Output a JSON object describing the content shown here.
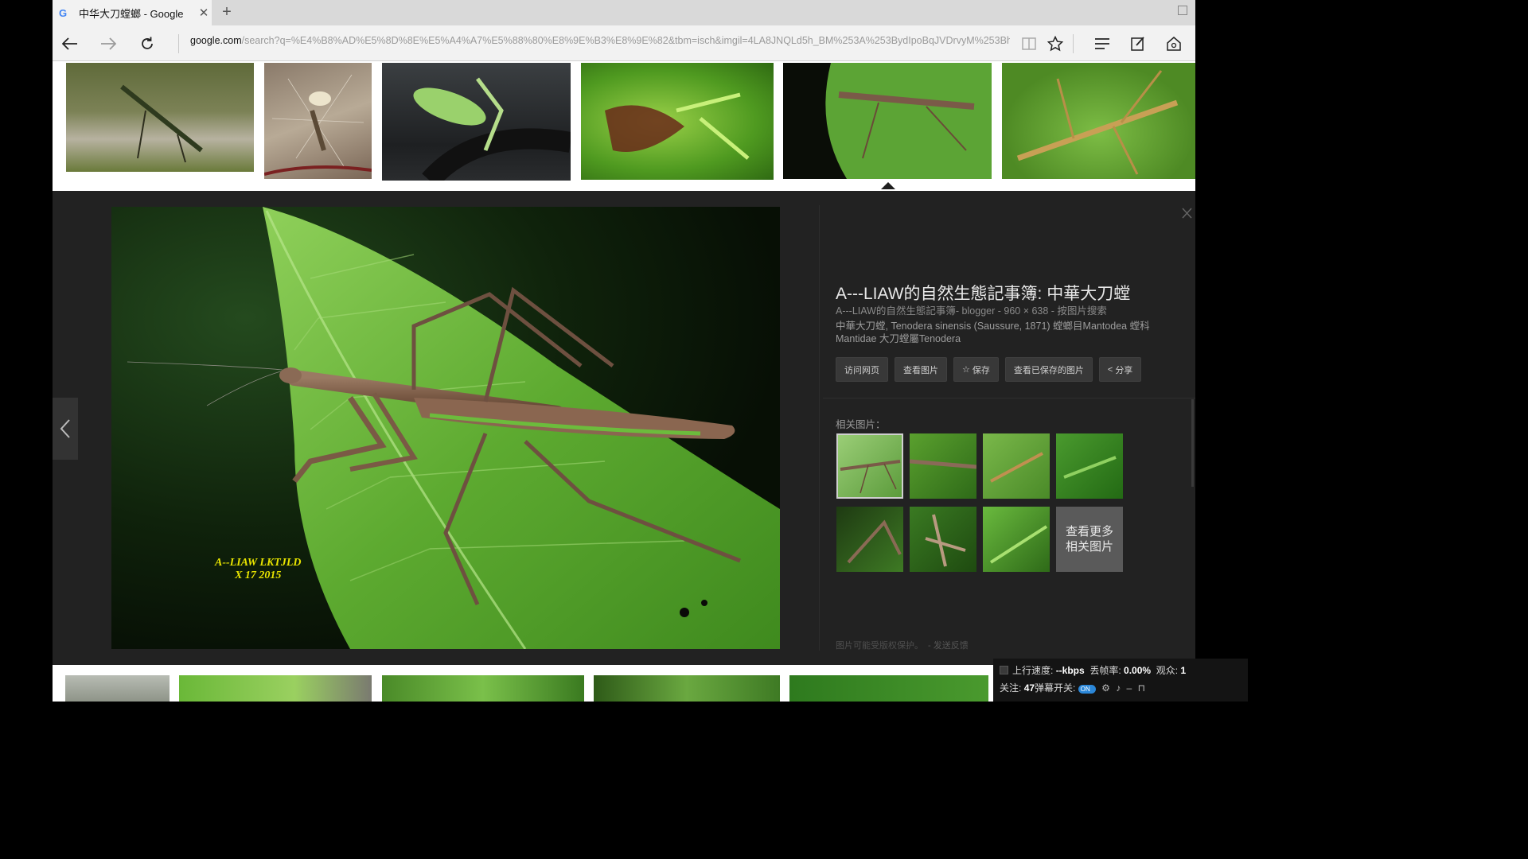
{
  "tab": {
    "title": "中华大刀螳螂 - Google"
  },
  "address_bar": {
    "domain": "google.com",
    "path": "/search?q=%E4%B8%AD%E5%8D%8E%E5%A4%A7%E5%88%80%E8%9E%B3%E8%9E%82&tbm=isch&imgil=4LA8JNQLd5h_BM%253A%253BydIpoBqJVDrvyM%253Bhttp"
  },
  "colors": {
    "panel_bg": "#222222",
    "accent_yellow": "#e8e400",
    "tab_bg": "#f2f2f2",
    "on_toggle": "#2b87d8"
  },
  "detail": {
    "title": "A---LIAW的自然生態記事簿: 中華大刀螳",
    "meta": "A---LIAW的自然生態記事簿- blogger - 960 × 638 - 按图片搜索",
    "description": "中華大刀螳, Tenodera sinensis (Saussure, 1871) 螳螂目Mantodea 螳科Mantidae 大刀螳屬Tenodera",
    "watermark_line1": "A--LIAW   LKTJLD",
    "watermark_line2": "X   17 2015",
    "actions": [
      {
        "label": "访问网页",
        "icon": ""
      },
      {
        "label": "查看图片",
        "icon": ""
      },
      {
        "label": "保存",
        "icon": "☆"
      },
      {
        "label": "查看已保存的图片",
        "icon": ""
      },
      {
        "label": "分享",
        "icon": "<"
      }
    ],
    "related_label": "相关图片：",
    "more_related": "查看更多相关图片",
    "footnote": "图片可能受版权保护。",
    "feedback": "- 发送反馈"
  },
  "live_overlay": {
    "upload_label": "上行速度:",
    "upload_value": "--kbps",
    "loss_label": "丢帧率:",
    "loss_value": "0.00%",
    "viewers_label": "观众:",
    "viewers_value": "1",
    "follow_label": "关注:",
    "follow_value": "47",
    "danmaku_label": "弹幕开关:",
    "toggle_label": "ON"
  }
}
